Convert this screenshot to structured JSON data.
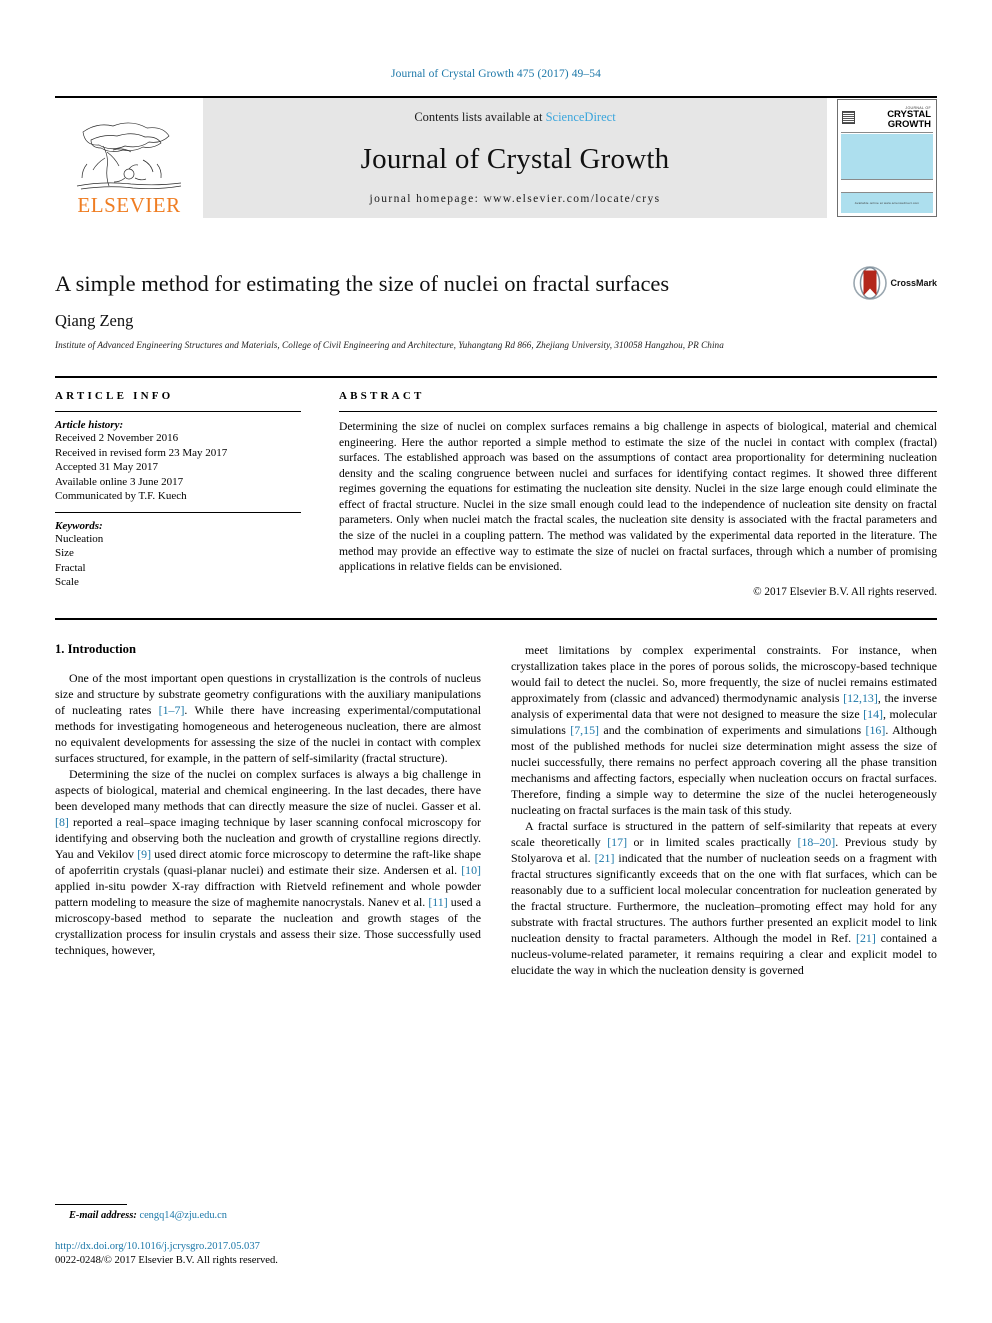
{
  "running_head": "Journal of Crystal Growth 475 (2017) 49–54",
  "masthead": {
    "contents_prefix": "Contents lists available at ",
    "sciencedirect": "ScienceDirect",
    "journal_name": "Journal of Crystal Growth",
    "homepage": "journal homepage: www.elsevier.com/locate/crys",
    "publisher": "ELSEVIER",
    "cover": {
      "journal_of": "JOURNAL OF",
      "line1": "CRYSTAL",
      "line2": "GROWTH",
      "footer": "Available online at www.sciencedirect.com"
    }
  },
  "article": {
    "title": "A simple method for estimating the size of nuclei on fractal surfaces",
    "author": "Qiang Zeng",
    "affiliation": "Institute of Advanced Engineering Structures and Materials, College of Civil Engineering and Architecture, Yuhangtang Rd 866, Zhejiang University, 310058 Hangzhou, PR China",
    "crossmark_label": "CrossMark"
  },
  "info": {
    "heading": "ARTICLE INFO",
    "history_label": "Article history:",
    "history": [
      "Received 2 November 2016",
      "Received in revised form 23 May 2017",
      "Accepted 31 May 2017",
      "Available online 3 June 2017",
      "Communicated by T.F. Kuech"
    ],
    "keywords_label": "Keywords:",
    "keywords": [
      "Nucleation",
      "Size",
      "Fractal",
      "Scale"
    ]
  },
  "abstract": {
    "heading": "ABSTRACT",
    "text": "Determining the size of nuclei on complex surfaces remains a big challenge in aspects of biological, material and chemical engineering. Here the author reported a simple method to estimate the size of the nuclei in contact with complex (fractal) surfaces. The established approach was based on the assumptions of contact area proportionality for determining nucleation density and the scaling congruence between nuclei and surfaces for identifying contact regimes. It showed three different regimes governing the equations for estimating the nucleation site density. Nuclei in the size large enough could eliminate the effect of fractal structure. Nuclei in the size small enough could lead to the independence of nucleation site density on fractal parameters. Only when nuclei match the fractal scales, the nucleation site density is associated with the fractal parameters and the size of the nuclei in a coupling pattern. The method was validated by the experimental data reported in the literature. The method may provide an effective way to estimate the size of nuclei on fractal surfaces, through which a number of promising applications in relative fields can be envisioned.",
    "copyright": "© 2017 Elsevier B.V. All rights reserved."
  },
  "body": {
    "section_title": "1. Introduction",
    "left_paragraphs": [
      "One of the most important open questions in crystallization is the controls of nucleus size and structure by substrate geometry configurations with the auxiliary manipulations of nucleating rates [1–7]. While there have increasing experimental/computational methods for investigating homogeneous and heterogeneous nucleation, there are almost no equivalent developments for assessing the size of the nuclei in contact with complex surfaces structured, for example, in the pattern of self-similarity (fractal structure).",
      "Determining the size of the nuclei on complex surfaces is always a big challenge in aspects of biological, material and chemical engineering. In the last decades, there have been developed many methods that can directly measure the size of nuclei. Gasser et al. [8] reported a real–space imaging technique by laser scanning confocal microscopy for identifying and observing both the nucleation and growth of crystalline regions directly. Yau and Vekilov [9] used direct atomic force microscopy to determine the raft-like shape of apoferritin crystals (quasi-planar nuclei) and estimate their size. Andersen et al. [10] applied in-situ powder X-ray diffraction with Rietveld refinement and whole powder pattern modeling to measure the size of maghemite nanocrystals. Nanev et al. [11] used a microscopy-based method to separate the nucleation and growth stages of the crystallization process for insulin crystals and assess their size. Those successfully used techniques, however,"
    ],
    "right_paragraphs": [
      "meet limitations by complex experimental constraints. For instance, when crystallization takes place in the pores of porous solids, the microscopy-based technique would fail to detect the nuclei. So, more frequently, the size of nuclei remains estimated approximately from (classic and advanced) thermodynamic analysis [12,13], the inverse analysis of experimental data that were not designed to measure the size [14], molecular simulations [7,15] and the combination of experiments and simulations [16]. Although most of the published methods for nuclei size determination might assess the size of nuclei successfully, there remains no perfect approach covering all the phase transition mechanisms and affecting factors, especially when nucleation occurs on fractal surfaces. Therefore, finding a simple way to determine the size of the nuclei heterogeneously nucleating on fractal surfaces is the main task of this study.",
      "A fractal surface is structured in the pattern of self-similarity that repeats at every scale theoretically [17] or in limited scales practically [18–20]. Previous study by Stolyarova et al. [21] indicated that the number of nucleation seeds on a fragment with fractal structures significantly exceeds that on the one with flat surfaces, which can be reasonably due to a sufficient local molecular concentration for nucleation generated by the fractal structure. Furthermore, the nucleation–promoting effect may hold for any substrate with fractal structures. The authors further presented an explicit model to link nucleation density to fractal parameters. Although the model in Ref. [21] contained a nucleus-volume-related parameter, it remains requiring a clear and explicit model to elucidate the way in which the nucleation density is governed"
    ]
  },
  "footnote": {
    "label": "E-mail address:",
    "email": "cengq14@zju.edu.cn"
  },
  "bottom": {
    "doi": "http://dx.doi.org/10.1016/j.jcrysgro.2017.05.037",
    "issn_line": "0022-0248/© 2017 Elsevier B.V. All rights reserved."
  },
  "colors": {
    "link_blue": "#1c77a8",
    "elsevier_orange": "#ef7d22",
    "sciencedirect_blue": "#3aa5dc",
    "cover_blue": "#addfee"
  }
}
